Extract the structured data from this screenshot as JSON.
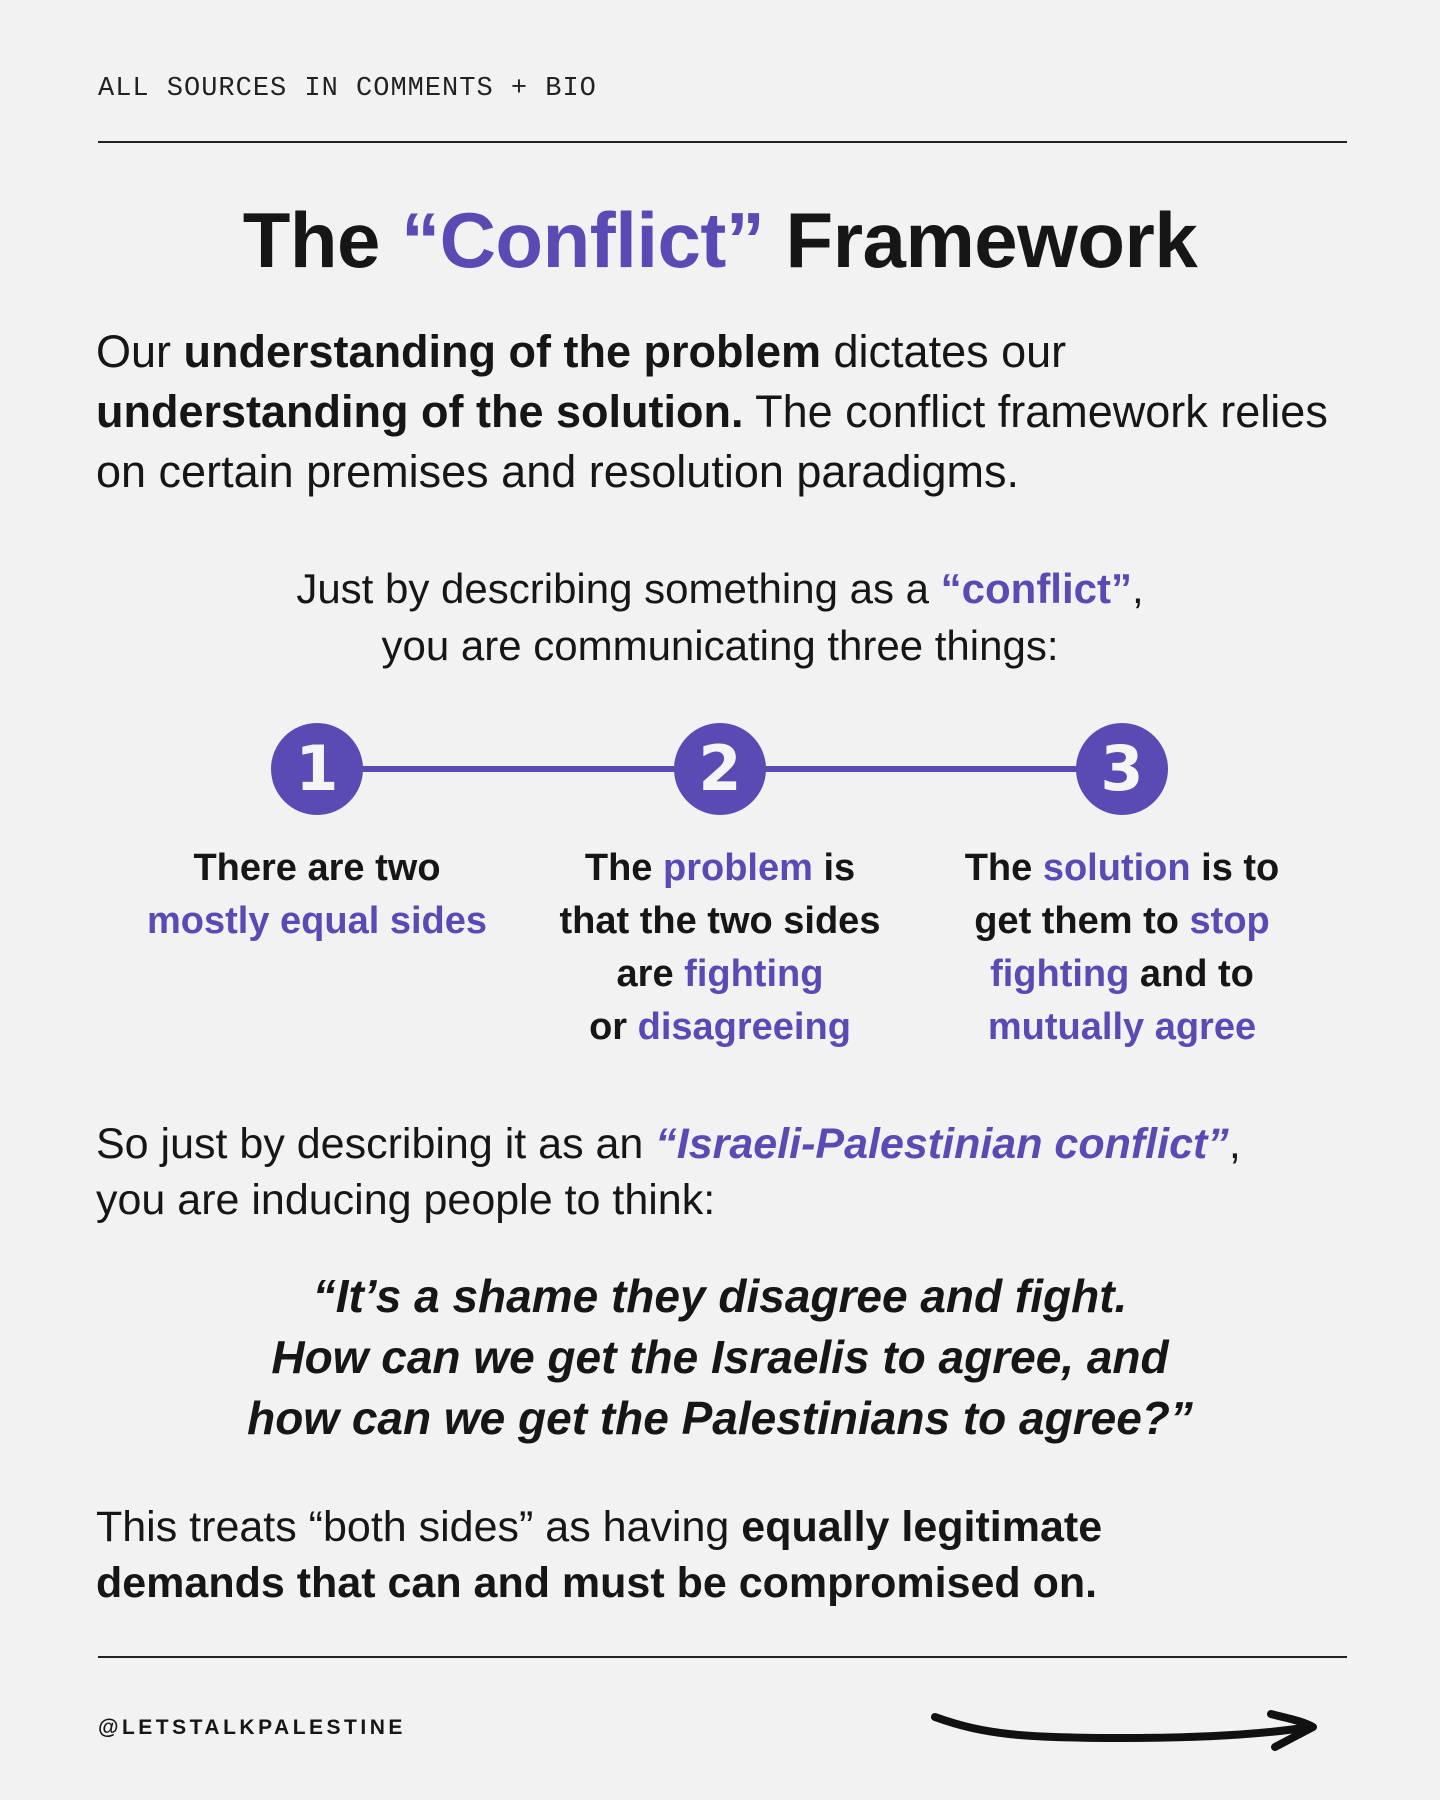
{
  "header": {
    "sources_note": "ALL SOURCES IN COMMENTS + BIO"
  },
  "title": {
    "before": "The ",
    "highlight": "“Conflict”",
    "after": " Framework"
  },
  "intro": {
    "s1": "Our ",
    "b1": "understanding of the problem",
    "s2": " dictates our ",
    "b2": "understanding of the solution.",
    "s3": " The conflict framework relies on certain premises and resolution paradigms."
  },
  "lead": {
    "s1": "Just by describing something as a ",
    "highlight": "“conflict”",
    "s2": ",",
    "line2": "you are communicating three things:"
  },
  "steps": [
    {
      "number": "1",
      "t1": "There are two",
      "h1": "mostly equal sides"
    },
    {
      "number": "2",
      "t1": "The ",
      "h1": "problem",
      "t2": " is",
      "t3": "that the two sides",
      "t4": "are ",
      "h2": "fighting",
      "t5": "or ",
      "h3": "disagreeing"
    },
    {
      "number": "3",
      "t1": "The ",
      "h1": "solution",
      "t2": " is to",
      "t3": "get them to ",
      "h2": "stop",
      "h3": "fighting",
      "t4": " and to",
      "h4": "mutually agree"
    }
  ],
  "so": {
    "s1": "So just by describing it as an ",
    "highlight": "“Israeli-Palestinian conflict”",
    "s2": ",",
    "line2": "you are inducing people to think:"
  },
  "quote": {
    "l1": "“It’s a shame they disagree and fight.",
    "l2": "How can we get the Israelis to agree, and",
    "l3": "how can we get the Palestinians to agree?”"
  },
  "closing": {
    "s1": "This treats “both sides” as having ",
    "b1": "equally legitimate",
    "b2": "demands that can and must be compromised on."
  },
  "footer": {
    "handle": "@LETSTALKPALESTINE",
    "next_icon": "arrow-right-icon"
  },
  "colors": {
    "accent": "#5a4bb4",
    "background": "#f2f2f2",
    "text": "#161616"
  }
}
